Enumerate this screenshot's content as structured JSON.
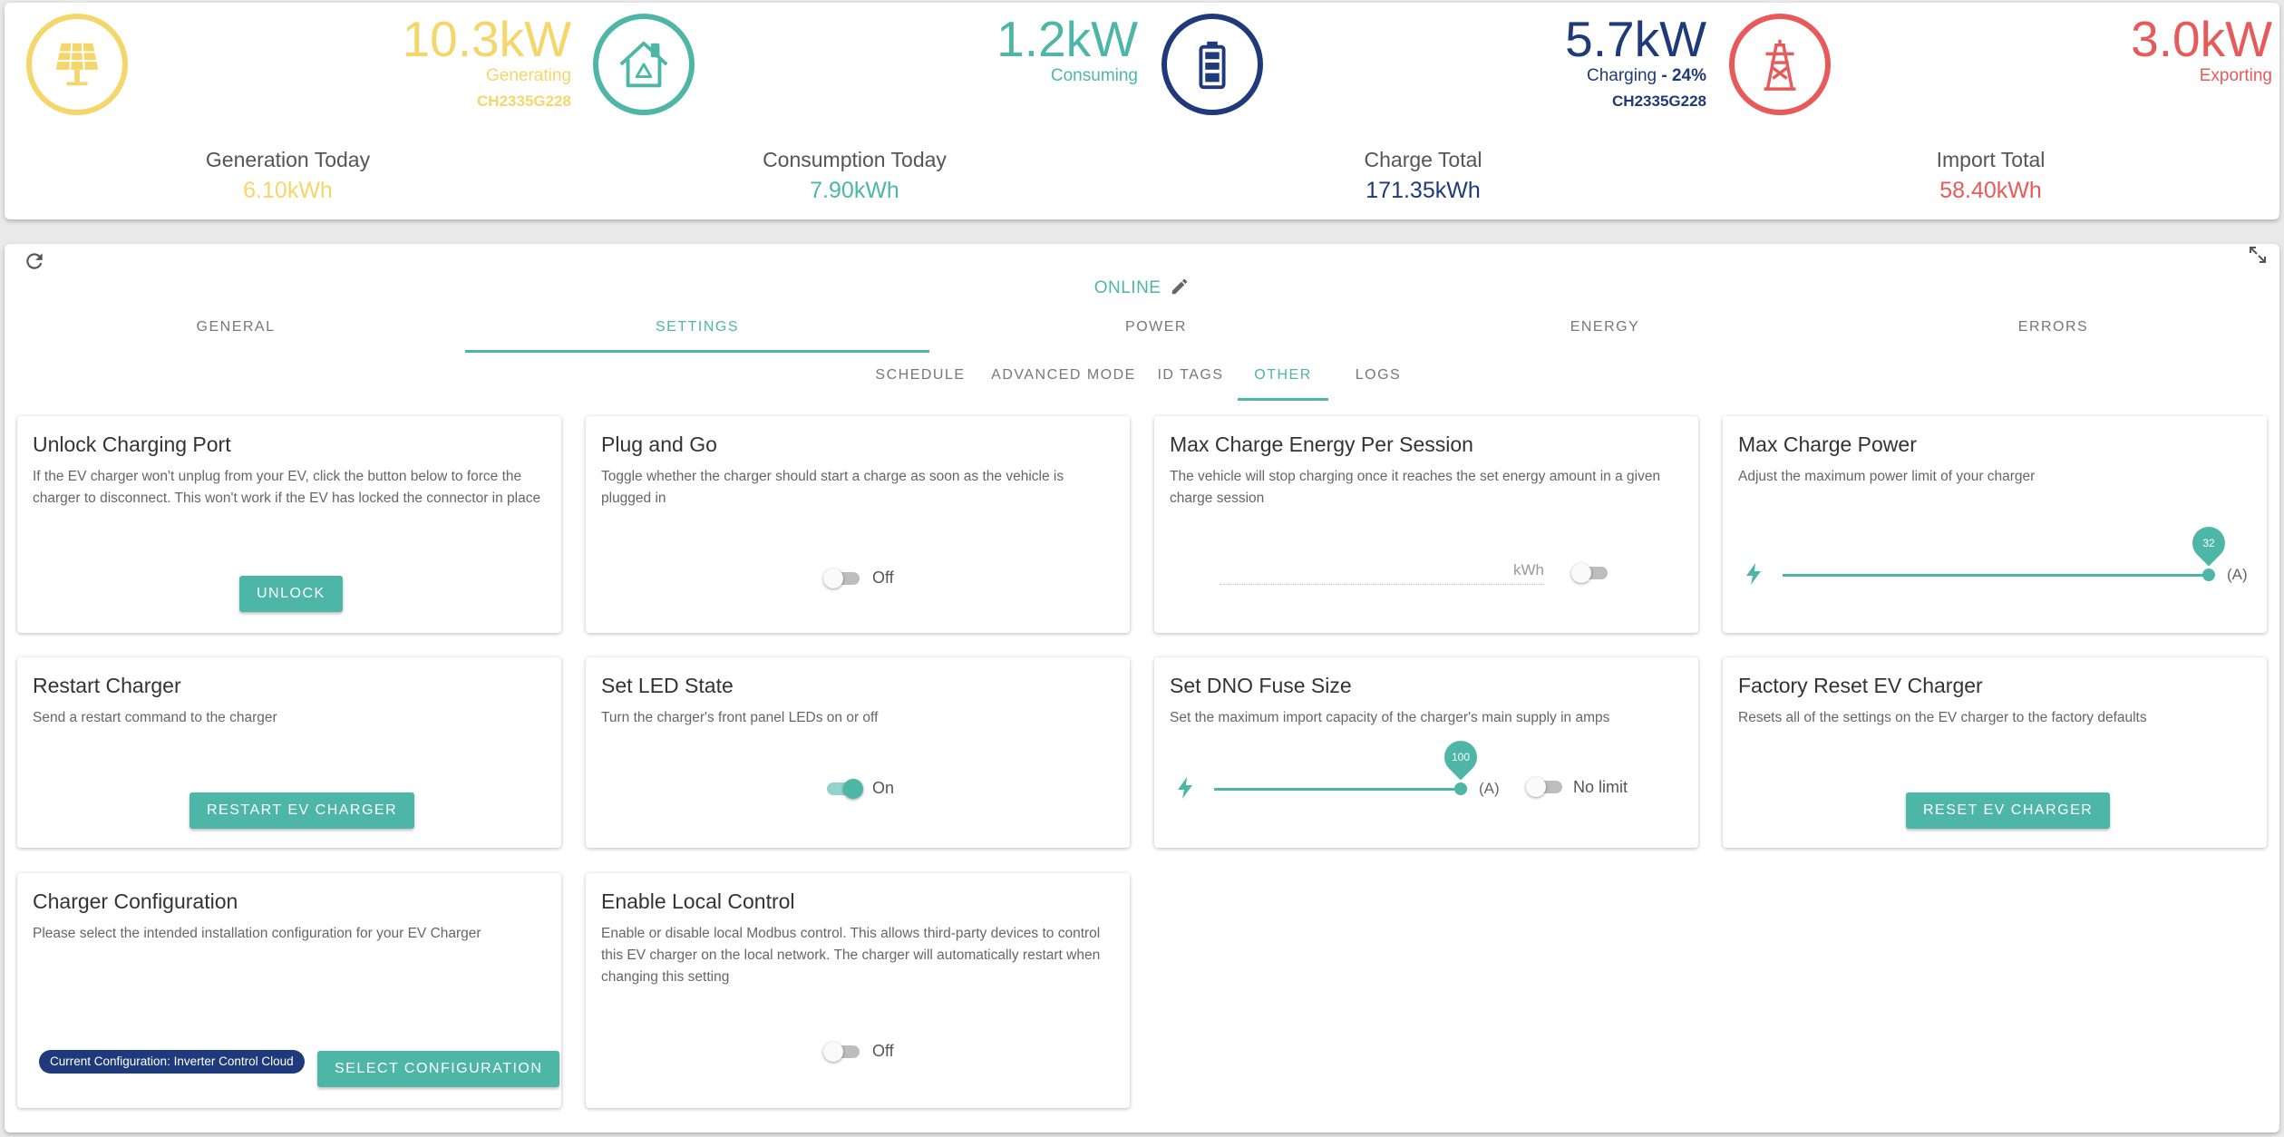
{
  "summary": {
    "generation": {
      "value": "10.3kW",
      "label": "Generating",
      "serial": "CH2335G228",
      "today_label": "Generation Today",
      "today_value": "6.10kWh",
      "icon": "solar-panel-icon",
      "color": "#f5d66a"
    },
    "consumption": {
      "value": "1.2kW",
      "label": "Consuming",
      "today_label": "Consumption Today",
      "today_value": "7.90kWh",
      "icon": "house-recycle-icon",
      "color": "#4db6a7"
    },
    "charging": {
      "value": "5.7kW",
      "label": "Charging",
      "separator": " - ",
      "percent": "24%",
      "serial": "CH2335G228",
      "today_label": "Charge Total",
      "today_value": "171.35kWh",
      "icon": "battery-icon",
      "color": "#1f3a7a"
    },
    "export": {
      "value": "3.0kW",
      "label": "Exporting",
      "today_label": "Import Total",
      "today_value": "58.40kWh",
      "icon": "pylon-icon",
      "color": "#e85a5a"
    }
  },
  "panel": {
    "status": "ONLINE",
    "tabs": [
      "GENERAL",
      "SETTINGS",
      "POWER",
      "ENERGY",
      "ERRORS"
    ],
    "active_tab": "SETTINGS",
    "subtabs": [
      "SCHEDULE",
      "ADVANCED MODE",
      "ID TAGS",
      "OTHER",
      "LOGS"
    ],
    "active_subtab": "OTHER"
  },
  "cards": {
    "unlock": {
      "title": "Unlock Charging Port",
      "desc": "If the EV charger won't unplug from your EV, click the button below to force the charger to disconnect. This won't work if the EV has locked the connector in place",
      "button": "UNLOCK"
    },
    "plug_and_go": {
      "title": "Plug and Go",
      "desc": "Toggle whether the charger should start a charge as soon as the vehicle is plugged in",
      "toggle_label": "Off"
    },
    "max_energy": {
      "title": "Max Charge Energy Per Session",
      "desc": "The vehicle will stop charging once it reaches the set energy amount in a given charge session",
      "unit": "kWh"
    },
    "max_power": {
      "title": "Max Charge Power",
      "desc": "Adjust the maximum power limit of your charger",
      "value": "32",
      "unit": "(A)",
      "level": 1.0
    },
    "restart": {
      "title": "Restart Charger",
      "desc": "Send a restart command to the charger",
      "button": "RESTART EV CHARGER"
    },
    "led": {
      "title": "Set LED State",
      "desc": "Turn the charger's front panel LEDs on or off",
      "toggle_label": "On"
    },
    "dno": {
      "title": "Set DNO Fuse Size",
      "desc": "Set the maximum import capacity of the charger's main supply in amps",
      "value": "100",
      "unit": "(A)",
      "toggle_label": "No limit",
      "level": 1.0
    },
    "factory_reset": {
      "title": "Factory Reset EV Charger",
      "desc": "Resets all of the settings on the EV charger to the factory defaults",
      "button": "RESET EV CHARGER"
    },
    "config": {
      "title": "Charger Configuration",
      "desc": "Please select the intended installation configuration for your EV Charger",
      "chip": "Current Configuration: Inverter Control Cloud",
      "button": "SELECT CONFIGURATION"
    },
    "local_control": {
      "title": "Enable Local Control",
      "desc": "Enable or disable local Modbus control. This allows third-party devices to control this EV charger on the local network. The charger will automatically restart when changing this setting",
      "toggle_label": "Off"
    }
  },
  "colors": {
    "accent": "#4db6a7",
    "navy": "#1f3a7a",
    "yellow": "#f5d66a",
    "red": "#e85a5a"
  }
}
